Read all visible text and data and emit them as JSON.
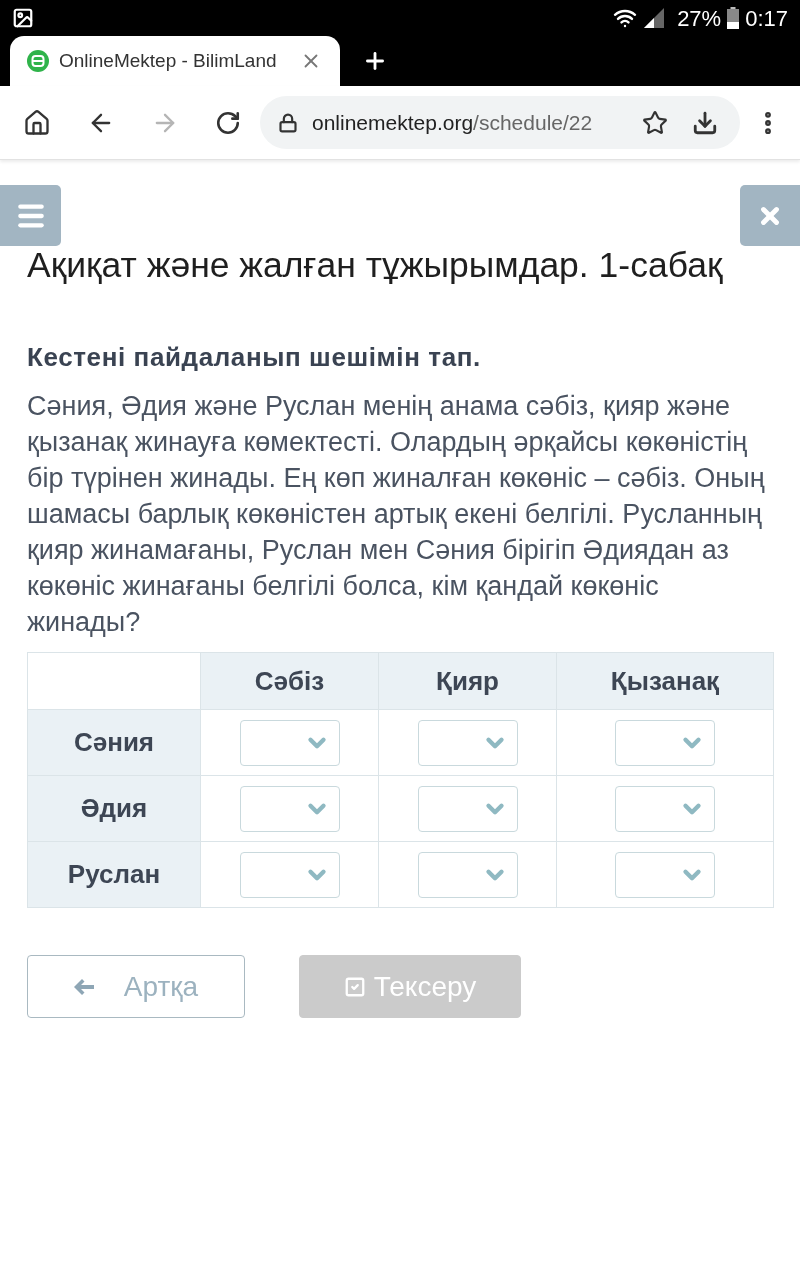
{
  "status_bar": {
    "battery": "27%",
    "time": "0:17"
  },
  "browser": {
    "tab": {
      "title": "OnlineMektep - BilimLand",
      "selected": true
    },
    "nav": [
      {
        "kind": "home",
        "disabled": false
      },
      {
        "kind": "back",
        "disabled": false
      },
      {
        "kind": "forward",
        "disabled": true
      },
      {
        "kind": "reload",
        "disabled": false
      }
    ],
    "address": {
      "host": "onlinemektep.org",
      "path": "/schedule/22"
    }
  },
  "page": {
    "title": "Ақиқат және жалған тұжырымдар. 1-сабақ",
    "instruction": "Кестені пайдаланып шешімін тап.",
    "problem": "Сәния, Әдия және Руслан менің анама сәбіз, қияр және қызанақ жинауға көмектесті. Олардың әрқайсы көкөністің бір түрінен жинады. Ең көп жиналған көкөніс – сәбіз. Оның шамасы барлық көкөністен артық екені белгілі. Русланның қияр жинамағаны, Руслан мен Сәния бірігіп Әдиядан аз көкөніс жинағаны белгілі болса, кім қандай көкөніс жинады?"
  },
  "table": {
    "columns": [
      "Сәбіз",
      "Қияр",
      "Қызанақ"
    ],
    "rows": [
      "Сәния",
      "Әдия",
      "Руслан"
    ]
  },
  "buttons": [
    {
      "kind": "back",
      "label": "Артқа",
      "disabled": false
    },
    {
      "kind": "check",
      "label": "Тексеру",
      "disabled": true
    }
  ]
}
